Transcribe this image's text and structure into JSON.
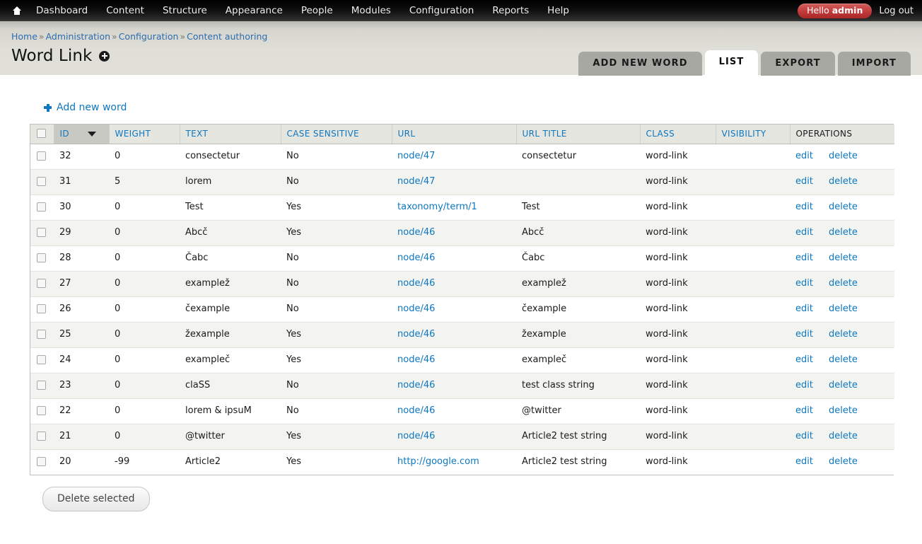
{
  "toolbar": {
    "home_icon": "home-icon",
    "menu": [
      {
        "label": "Dashboard"
      },
      {
        "label": "Content"
      },
      {
        "label": "Structure"
      },
      {
        "label": "Appearance"
      },
      {
        "label": "People"
      },
      {
        "label": "Modules"
      },
      {
        "label": "Configuration"
      },
      {
        "label": "Reports"
      },
      {
        "label": "Help"
      }
    ],
    "greeting_prefix": "Hello ",
    "user_name": "admin",
    "logout_label": "Log out"
  },
  "breadcrumb": {
    "items": [
      {
        "label": "Home"
      },
      {
        "label": "Administration"
      },
      {
        "label": "Configuration"
      },
      {
        "label": "Content authoring"
      }
    ],
    "separator": "»"
  },
  "page": {
    "title": "Word Link",
    "title_badge_icon": "plus-circle-icon"
  },
  "tabs": [
    {
      "label": "ADD NEW WORD",
      "active": false
    },
    {
      "label": "LIST",
      "active": true
    },
    {
      "label": "EXPORT",
      "active": false
    },
    {
      "label": "IMPORT",
      "active": false
    }
  ],
  "actions": {
    "add_new_word_label": "Add new word",
    "add_new_word_icon": "plus-icon",
    "delete_selected_label": "Delete selected"
  },
  "table": {
    "select_all_name": "select-all-checkbox",
    "sort_column": "ID",
    "sort_direction": "desc",
    "sort_arrow_icon": "chevron-down-icon",
    "headers": [
      {
        "label": "",
        "key": "check"
      },
      {
        "label": "ID",
        "key": "id"
      },
      {
        "label": "WEIGHT",
        "key": "weight"
      },
      {
        "label": "TEXT",
        "key": "text"
      },
      {
        "label": "CASE SENSITIVE",
        "key": "case"
      },
      {
        "label": "URL",
        "key": "url"
      },
      {
        "label": "URL TITLE",
        "key": "urltitle"
      },
      {
        "label": "CLASS",
        "key": "class"
      },
      {
        "label": "VISIBILITY",
        "key": "visibility"
      },
      {
        "label": "OPERATIONS",
        "key": "ops"
      }
    ],
    "ops_labels": {
      "edit": "edit",
      "delete": "delete"
    },
    "rows": [
      {
        "id": "32",
        "weight": "0",
        "text": "consectetur",
        "case": "No",
        "url": "node/47",
        "urltitle": "consectetur",
        "class": "word-link",
        "visibility": ""
      },
      {
        "id": "31",
        "weight": "5",
        "text": "lorem",
        "case": "No",
        "url": "node/47",
        "urltitle": "",
        "class": "word-link",
        "visibility": ""
      },
      {
        "id": "30",
        "weight": "0",
        "text": "Test",
        "case": "Yes",
        "url": "taxonomy/term/1",
        "urltitle": "Test",
        "class": "word-link",
        "visibility": ""
      },
      {
        "id": "29",
        "weight": "0",
        "text": "Abcč",
        "case": "Yes",
        "url": "node/46",
        "urltitle": "Abcč",
        "class": "word-link",
        "visibility": ""
      },
      {
        "id": "28",
        "weight": "0",
        "text": "Čabc",
        "case": "No",
        "url": "node/46",
        "urltitle": "Čabc",
        "class": "word-link",
        "visibility": ""
      },
      {
        "id": "27",
        "weight": "0",
        "text": "examplež",
        "case": "No",
        "url": "node/46",
        "urltitle": "examplež",
        "class": "word-link",
        "visibility": ""
      },
      {
        "id": "26",
        "weight": "0",
        "text": "čexample",
        "case": "No",
        "url": "node/46",
        "urltitle": "čexample",
        "class": "word-link",
        "visibility": ""
      },
      {
        "id": "25",
        "weight": "0",
        "text": "žexample",
        "case": "Yes",
        "url": "node/46",
        "urltitle": "žexample",
        "class": "word-link",
        "visibility": ""
      },
      {
        "id": "24",
        "weight": "0",
        "text": "exampleč",
        "case": "Yes",
        "url": "node/46",
        "urltitle": "exampleč",
        "class": "word-link",
        "visibility": ""
      },
      {
        "id": "23",
        "weight": "0",
        "text": "claSS",
        "case": "No",
        "url": "node/46",
        "urltitle": "test class string",
        "class": "word-link",
        "visibility": ""
      },
      {
        "id": "22",
        "weight": "0",
        "text": "lorem & ipsuM",
        "case": "No",
        "url": "node/46",
        "urltitle": "@twitter",
        "class": "word-link",
        "visibility": ""
      },
      {
        "id": "21",
        "weight": "0",
        "text": "@twitter",
        "case": "Yes",
        "url": "node/46",
        "urltitle": "Article2 test string",
        "class": "word-link",
        "visibility": ""
      },
      {
        "id": "20",
        "weight": "-99",
        "text": "Article2",
        "case": "Yes",
        "url": "http://google.com",
        "urltitle": "Article2 test string",
        "class": "word-link",
        "visibility": ""
      }
    ]
  },
  "colors": {
    "link": "#0d77c0",
    "toolbar_bg": "#000000",
    "badge_red": "#c43d3d",
    "header_band": "#e0e0d9",
    "row_odd": "#f3f4ef"
  }
}
